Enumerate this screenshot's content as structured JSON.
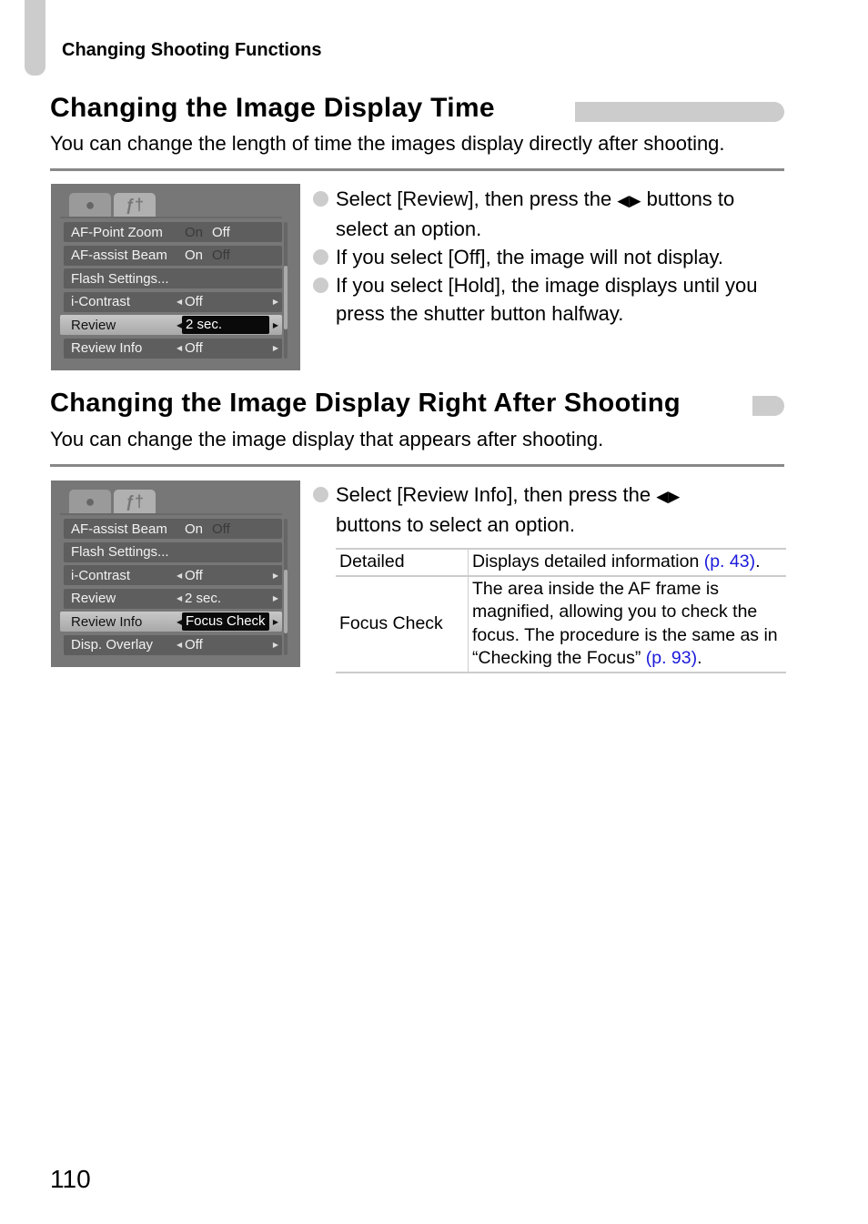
{
  "header": {
    "chapter": "Changing Shooting Functions"
  },
  "sections": [
    {
      "title": "Changing the Image Display Time",
      "intro": "You can change the length of time the images display directly after shooting.",
      "screen": {
        "tabs": [
          "camera-icon",
          "tools-icon"
        ],
        "rows": [
          {
            "label": "AF-Point Zoom",
            "on": "On",
            "off": "Off"
          },
          {
            "label": "AF-assist Beam",
            "on": "On",
            "off": "Off"
          },
          {
            "label": "Flash Settings..."
          },
          {
            "label": "i-Contrast",
            "value": "Off"
          },
          {
            "label": "Review",
            "value": "2 sec.",
            "selected": true
          },
          {
            "label": "Review Info",
            "value": "Off"
          }
        ]
      },
      "bullets": [
        {
          "pre": "Select [Review], then press the ",
          "arrows": "◀▶",
          "post": " buttons to select an option."
        },
        {
          "text": "If you select [Off], the image will not display."
        },
        {
          "text": "If you select [Hold], the image displays until you press the shutter button halfway."
        }
      ]
    },
    {
      "title": "Changing the Image Display Right After Shooting",
      "intro": "You can change the image display that appears after shooting.",
      "screen": {
        "tabs": [
          "camera-icon",
          "tools-icon"
        ],
        "rows": [
          {
            "label": "AF-assist Beam",
            "on": "On",
            "off": "Off"
          },
          {
            "label": "Flash Settings..."
          },
          {
            "label": "i-Contrast",
            "value": "Off"
          },
          {
            "label": "Review",
            "value": "2 sec."
          },
          {
            "label": "Review Info",
            "value": "Focus Check",
            "selected": true
          },
          {
            "label": "Disp. Overlay",
            "value": "Off"
          }
        ]
      },
      "bullets": [
        {
          "pre": "Select [Review Info], then press the ",
          "arrows": "◀▶",
          "post": " buttons to select an option."
        }
      ],
      "table": [
        {
          "option": "Detailed",
          "desc": "Displays detailed information ",
          "link": "(p. 43)",
          "end": "."
        },
        {
          "option": "Focus Check",
          "desc": "The area inside the AF frame is magnified, allowing you to check the focus. The procedure is the same as in “Checking the Focus” ",
          "link": "(p. 93)",
          "end": "."
        }
      ]
    }
  ],
  "page_number": "110"
}
